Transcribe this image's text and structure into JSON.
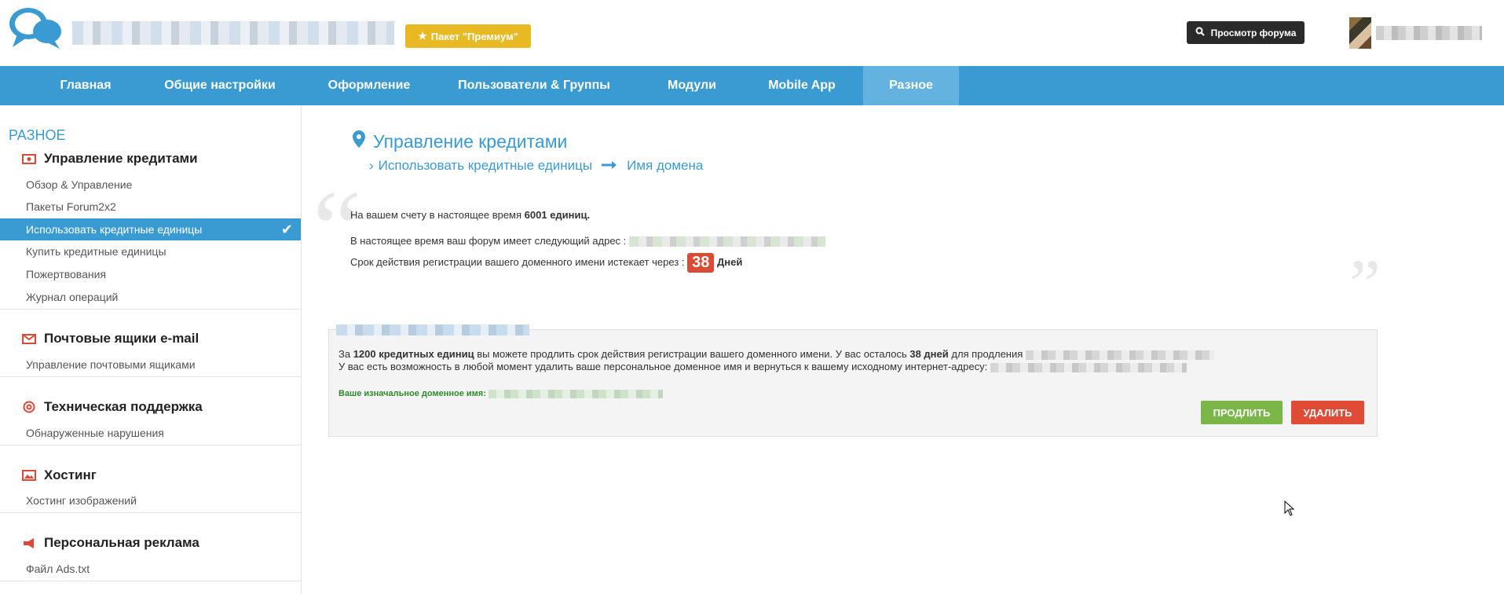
{
  "header": {
    "premium_label": "Пакет \"Премиум\"",
    "view_forum_label": "Просмотр форума"
  },
  "nav": {
    "items": [
      {
        "label": "Главная"
      },
      {
        "label": "Общие настройки"
      },
      {
        "label": "Оформление"
      },
      {
        "label": "Пользователи & Группы"
      },
      {
        "label": "Модули"
      },
      {
        "label": "Mobile App"
      },
      {
        "label": "Разное"
      }
    ],
    "active_index": 6
  },
  "sidebar": {
    "title": "РАЗНОЕ",
    "groups": [
      {
        "label": "Управление кредитами",
        "icon": "money-icon",
        "items": [
          "Обзор & Управление",
          "Пакеты Forum2x2",
          "Использовать кредитные единицы",
          "Купить кредитные единицы",
          "Пожертвования",
          "Журнал операций"
        ]
      },
      {
        "label": "Почтовые ящики e-mail",
        "icon": "envelope-icon",
        "items": [
          "Управление почтовыми ящиками"
        ]
      },
      {
        "label": "Техническая поддержка",
        "icon": "lifebuoy-icon",
        "items": [
          "Обнаруженные нарушения"
        ]
      },
      {
        "label": "Хостинг",
        "icon": "image-icon",
        "items": [
          "Хостинг изображений"
        ]
      },
      {
        "label": "Персональная реклама",
        "icon": "megaphone-icon",
        "items": [
          "Файл Ads.txt"
        ]
      }
    ],
    "active_item": "Использовать кредитные единицы"
  },
  "main": {
    "title": "Управление кредитами",
    "breadcrumb": [
      "Использовать кредитные единицы",
      "Имя домена"
    ],
    "balance_prefix": "На вашем счету в настоящее время ",
    "balance_value": "6001 единиц.",
    "address_prefix": "В настоящее время ваш форум имеет следующий адрес : ",
    "expiry_prefix": "Срок действия регистрации вашего доменного имени истекает через : ",
    "expiry_days": "38",
    "expiry_unit": "Дней",
    "box": {
      "line1_a": "За ",
      "line1_b": "1200 кредитных единиц",
      "line1_c": " вы можете продлить срок действия регистрации вашего доменного имени. У вас осталось ",
      "line1_d": "38 дней",
      "line1_e": " для продления ",
      "line2": "У вас есть возможность в любой момент удалить ваше персональное доменное имя и вернуться к вашему исходному интернет-адресу: ",
      "original_domain_label": "Ваше изначальное доменное имя: ",
      "extend_label": "ПРОДЛИТЬ",
      "delete_label": "УДАЛИТЬ"
    }
  },
  "colors": {
    "accent": "#3a9ad2",
    "premium": "#e8b923",
    "extend": "#7ab648",
    "delete": "#e04b35"
  }
}
